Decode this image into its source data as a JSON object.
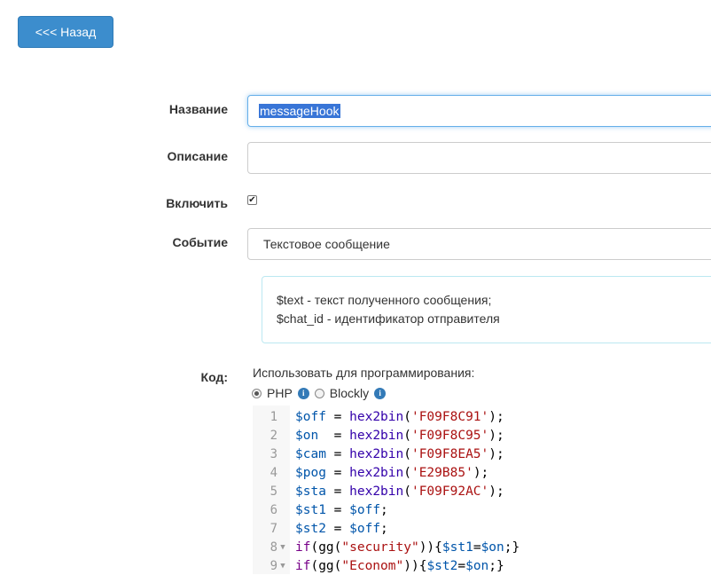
{
  "back_button": {
    "label": "<<< Назад"
  },
  "form": {
    "name": {
      "label": "Название",
      "value": "messageHook"
    },
    "description": {
      "label": "Описание",
      "value": ""
    },
    "enable": {
      "label": "Включить",
      "checked": true
    },
    "event": {
      "label": "Событие",
      "value": "Текстовое сообщение"
    },
    "help": {
      "line1": "$text - текст полученного сообщения;",
      "line2": "$chat_id - идентификатор отправителя"
    },
    "code": {
      "label": "Код:",
      "use_label": "Использовать для программирования:",
      "options": [
        {
          "label": "PHP",
          "selected": true
        },
        {
          "label": "Blockly",
          "selected": false
        }
      ],
      "lines": [
        {
          "n": "1",
          "fold": "",
          "tokens": [
            [
              "var",
              "$off"
            ],
            [
              "plain",
              " = "
            ],
            [
              "fn",
              "hex2bin"
            ],
            [
              "plain",
              "("
            ],
            [
              "str",
              "'F09F8C91'"
            ],
            [
              "plain",
              ");"
            ]
          ]
        },
        {
          "n": "2",
          "fold": "",
          "tokens": [
            [
              "var",
              "$on"
            ],
            [
              "plain",
              "  = "
            ],
            [
              "fn",
              "hex2bin"
            ],
            [
              "plain",
              "("
            ],
            [
              "str",
              "'F09F8C95'"
            ],
            [
              "plain",
              ");"
            ]
          ]
        },
        {
          "n": "3",
          "fold": "",
          "tokens": [
            [
              "var",
              "$cam"
            ],
            [
              "plain",
              " = "
            ],
            [
              "fn",
              "hex2bin"
            ],
            [
              "plain",
              "("
            ],
            [
              "str",
              "'F09F8EA5'"
            ],
            [
              "plain",
              ");"
            ]
          ]
        },
        {
          "n": "4",
          "fold": "",
          "tokens": [
            [
              "var",
              "$pog"
            ],
            [
              "plain",
              " = "
            ],
            [
              "fn",
              "hex2bin"
            ],
            [
              "plain",
              "("
            ],
            [
              "str",
              "'E29B85'"
            ],
            [
              "plain",
              ");"
            ]
          ]
        },
        {
          "n": "5",
          "fold": "",
          "tokens": [
            [
              "var",
              "$sta"
            ],
            [
              "plain",
              " = "
            ],
            [
              "fn",
              "hex2bin"
            ],
            [
              "plain",
              "("
            ],
            [
              "str",
              "'F09F92AC'"
            ],
            [
              "plain",
              ");"
            ]
          ]
        },
        {
          "n": "6",
          "fold": "",
          "tokens": [
            [
              "var",
              "$st1"
            ],
            [
              "plain",
              " = "
            ],
            [
              "var",
              "$off"
            ],
            [
              "plain",
              ";"
            ]
          ]
        },
        {
          "n": "7",
          "fold": "",
          "tokens": [
            [
              "var",
              "$st2"
            ],
            [
              "plain",
              " = "
            ],
            [
              "var",
              "$off"
            ],
            [
              "plain",
              ";"
            ]
          ]
        },
        {
          "n": "8",
          "fold": "▼",
          "tokens": [
            [
              "kw",
              "if"
            ],
            [
              "plain",
              "(gg("
            ],
            [
              "str",
              "\"security\""
            ],
            [
              "plain",
              ")){"
            ],
            [
              "var",
              "$st1"
            ],
            [
              "plain",
              "="
            ],
            [
              "var",
              "$on"
            ],
            [
              "plain",
              ";}"
            ]
          ]
        },
        {
          "n": "9",
          "fold": "▼",
          "tokens": [
            [
              "kw",
              "if"
            ],
            [
              "plain",
              "(gg("
            ],
            [
              "str",
              "\"Econom\""
            ],
            [
              "plain",
              ")){"
            ],
            [
              "var",
              "$st2"
            ],
            [
              "plain",
              "="
            ],
            [
              "var",
              "$on"
            ],
            [
              "plain",
              ";}"
            ]
          ]
        }
      ]
    }
  }
}
